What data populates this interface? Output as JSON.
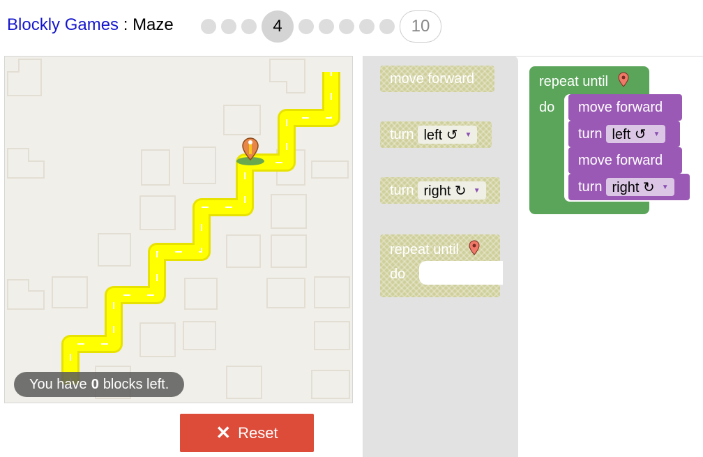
{
  "header": {
    "app_name": "Blockly Games",
    "separator": " : ",
    "game_name": "Maze",
    "levels": [
      "1",
      "2",
      "3",
      "4",
      "5",
      "6",
      "7",
      "8",
      "9",
      "10"
    ],
    "current_level": "4",
    "last_level": "10"
  },
  "maze": {
    "capacity_prefix": "You have",
    "capacity_count": "0",
    "capacity_suffix": "blocks left."
  },
  "reset_button": {
    "label": "Reset",
    "icon": "close-icon"
  },
  "toolbox": {
    "move_forward": "move forward",
    "turn_left_label": "turn",
    "turn_left_value": "left ↺",
    "turn_right_label": "turn",
    "turn_right_value": "right ↻",
    "repeat_until": "repeat until",
    "do": "do",
    "marker_icon": "map-marker-icon"
  },
  "program": {
    "repeat_until": "repeat until",
    "do": "do",
    "steps": [
      {
        "label": "move forward",
        "value": ""
      },
      {
        "label": "turn",
        "value": "left ↺"
      },
      {
        "label": "move forward",
        "value": ""
      },
      {
        "label": "turn",
        "value": "right ↻"
      }
    ]
  },
  "colors": {
    "title_link": "#1515cc",
    "reset": "#dd4b39",
    "loop_block": "#5ba55b",
    "movement_block": "#9b59b6",
    "path": "#ffff00"
  }
}
